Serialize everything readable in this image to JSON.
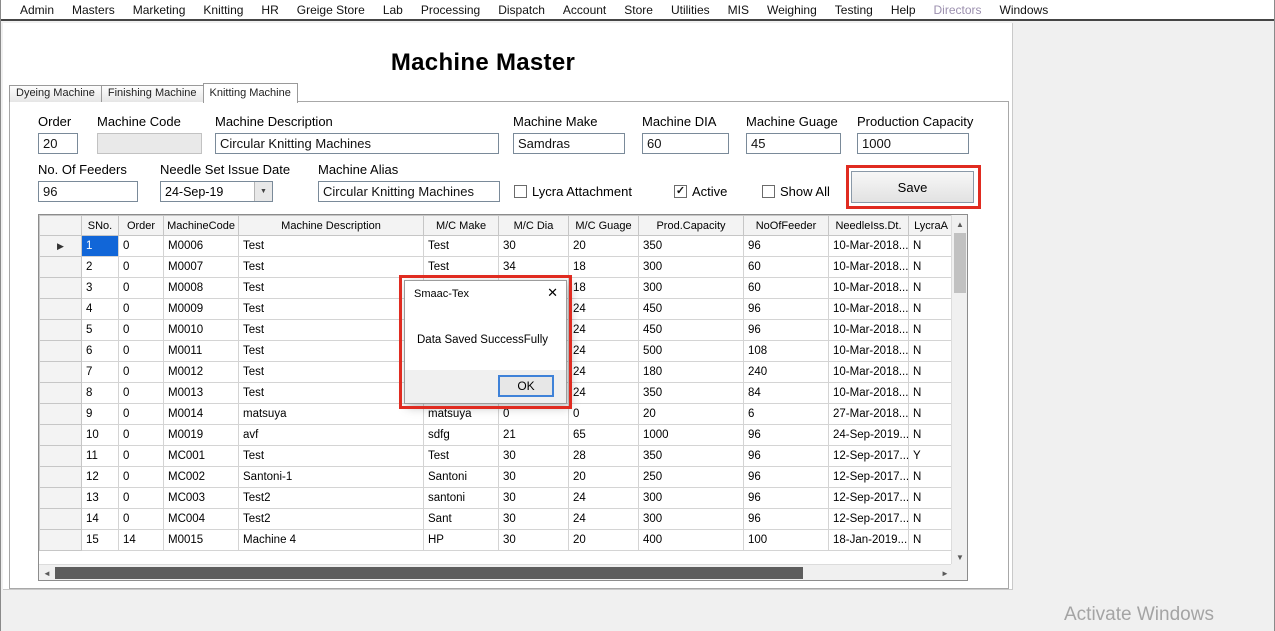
{
  "window": {
    "menu_items": [
      {
        "label": "Admin"
      },
      {
        "label": "Masters"
      },
      {
        "label": "Marketing"
      },
      {
        "label": "Knitting"
      },
      {
        "label": "HR"
      },
      {
        "label": "Greige Store"
      },
      {
        "label": "Lab"
      },
      {
        "label": "Processing"
      },
      {
        "label": "Dispatch"
      },
      {
        "label": "Account"
      },
      {
        "label": "Store"
      },
      {
        "label": "Utilities"
      },
      {
        "label": "MIS"
      },
      {
        "label": "Weighing"
      },
      {
        "label": "Testing"
      },
      {
        "label": "Help"
      },
      {
        "label": "Directors",
        "muted": true
      },
      {
        "label": "Windows"
      }
    ],
    "watermark": "Activate Windows"
  },
  "page": {
    "title": "Machine Master",
    "tabs": [
      {
        "label": "Dyeing Machine",
        "active": false
      },
      {
        "label": "Finishing Machine",
        "active": false
      },
      {
        "label": "Knitting Machine",
        "active": true
      }
    ]
  },
  "form": {
    "order": {
      "label": "Order",
      "value": "20"
    },
    "machine_code": {
      "label": "Machine Code",
      "value": ""
    },
    "machine_description": {
      "label": "Machine Description",
      "value": "Circular Knitting Machines"
    },
    "machine_make": {
      "label": "Machine Make",
      "value": "Samdras"
    },
    "machine_dia": {
      "label": "Machine DIA",
      "value": "60"
    },
    "machine_guage": {
      "label": "Machine Guage",
      "value": "45"
    },
    "production_capacity": {
      "label": "Production Capacity",
      "value": "1000"
    },
    "no_of_feeders": {
      "label": "No. Of Feeders",
      "value": "96"
    },
    "needle_set_issue_date": {
      "label": "Needle Set Issue Date",
      "value": "24-Sep-19"
    },
    "machine_alias": {
      "label": "Machine Alias",
      "value": "Circular Knitting Machines"
    },
    "checkboxes": {
      "lycra_attachment": {
        "label": "Lycra Attachment",
        "checked": false
      },
      "active": {
        "label": "Active",
        "checked": true
      },
      "show_all": {
        "label": "Show All",
        "checked": false
      }
    },
    "save_label": "Save"
  },
  "grid": {
    "columns": [
      "SNo.",
      "Order",
      "MachineCode",
      "Machine Description",
      "M/C Make",
      "M/C Dia",
      "M/C Guage",
      "Prod.Capacity",
      "NoOfFeeder",
      "NeedleIss.Dt.",
      "LycraA"
    ],
    "selected_row": 1,
    "rows": [
      [
        "1",
        "0",
        "M0006",
        "Test",
        "Test",
        "30",
        "20",
        "350",
        "96",
        "10-Mar-2018...",
        "N"
      ],
      [
        "2",
        "0",
        "M0007",
        "Test",
        "Test",
        "34",
        "18",
        "300",
        "60",
        "10-Mar-2018...",
        "N"
      ],
      [
        "3",
        "0",
        "M0008",
        "Test",
        "",
        "",
        "18",
        "300",
        "60",
        "10-Mar-2018...",
        "N"
      ],
      [
        "4",
        "0",
        "M0009",
        "Test",
        "",
        "",
        "24",
        "450",
        "96",
        "10-Mar-2018...",
        "N"
      ],
      [
        "5",
        "0",
        "M0010",
        "Test",
        "",
        "",
        "24",
        "450",
        "96",
        "10-Mar-2018...",
        "N"
      ],
      [
        "6",
        "0",
        "M0011",
        "Test",
        "",
        "",
        "24",
        "500",
        "108",
        "10-Mar-2018...",
        "N"
      ],
      [
        "7",
        "0",
        "M0012",
        "Test",
        "",
        "",
        "24",
        "180",
        "240",
        "10-Mar-2018...",
        "N"
      ],
      [
        "8",
        "0",
        "M0013",
        "Test",
        "",
        "",
        "24",
        "350",
        "84",
        "10-Mar-2018...",
        "N"
      ],
      [
        "9",
        "0",
        "M0014",
        "matsuya",
        "matsuya",
        "0",
        "0",
        "20",
        "6",
        "27-Mar-2018...",
        "N"
      ],
      [
        "10",
        "0",
        "M0019",
        "avf",
        "sdfg",
        "21",
        "65",
        "1000",
        "96",
        "24-Sep-2019...",
        "N"
      ],
      [
        "11",
        "0",
        "MC001",
        "Test",
        "Test",
        "30",
        "28",
        "350",
        "96",
        "12-Sep-2017...",
        "Y"
      ],
      [
        "12",
        "0",
        "MC002",
        "Santoni-1",
        "Santoni",
        "30",
        "20",
        "250",
        "96",
        "12-Sep-2017...",
        "N"
      ],
      [
        "13",
        "0",
        "MC003",
        "Test2",
        "santoni",
        "30",
        "24",
        "300",
        "96",
        "12-Sep-2017...",
        "N"
      ],
      [
        "14",
        "0",
        "MC004",
        "Test2",
        "Sant",
        "30",
        "24",
        "300",
        "96",
        "12-Sep-2017...",
        "N"
      ],
      [
        "15",
        "14",
        "M0015",
        "Machine 4",
        "HP",
        "30",
        "20",
        "400",
        "100",
        "18-Jan-2019...",
        "N"
      ]
    ]
  },
  "dialog": {
    "title": "Smaac-Tex",
    "message": "Data Saved SuccessFully",
    "ok_label": "OK",
    "close_glyph": "✕"
  },
  "icons": {
    "check": "✓",
    "dropdown": "▼",
    "row_marker": "▶",
    "scroll_up": "▲",
    "scroll_down": "▼",
    "scroll_left": "◄",
    "scroll_right": "►"
  },
  "colors": {
    "selection": "#1166d8",
    "annotation": "#e02b20",
    "muted_menu": "#9b8fae",
    "hscroll_thumb": "#5d5d5d"
  }
}
